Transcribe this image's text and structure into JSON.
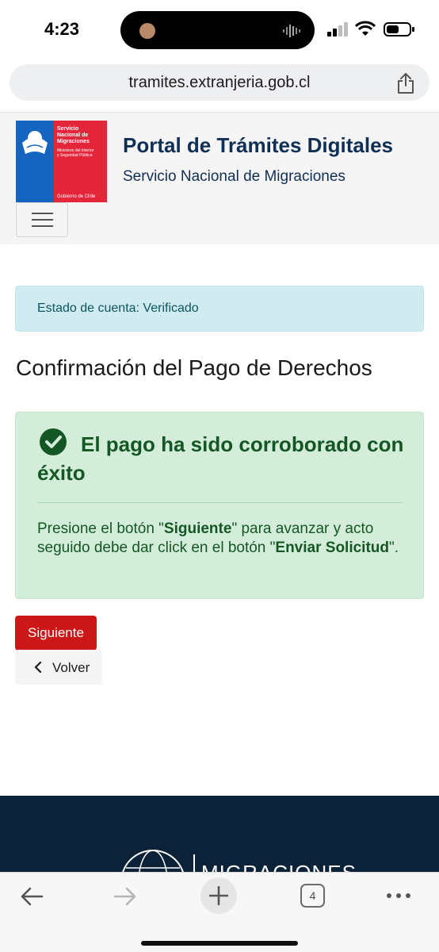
{
  "status_bar": {
    "time": "4:23"
  },
  "browser": {
    "url": "tramites.extranjeria.gob.cl",
    "tab_count": "4"
  },
  "header": {
    "logo": {
      "line1": "Servicio",
      "line2": "Nacional de",
      "line3": "Migraciones",
      "line4": "Ministerio del Interior",
      "line5": "y Seguridad Pública",
      "line6": "Gobierno de Chile"
    },
    "title": "Portal de Trámites Digitales",
    "subtitle": "Servicio Nacional de Migraciones"
  },
  "account_alert": {
    "text": "Estado de cuenta: Verificado"
  },
  "page_title": "Confirmación del Pago de Derechos",
  "success": {
    "heading": "El pago ha sido corroborado con éxito",
    "body_part1": "Presione el botón ",
    "body_quote1": "\"",
    "body_bold1": "Siguiente",
    "body_quote2": "\"",
    "body_part2": " para avanzar y acto seguido debe dar click en el botón ",
    "body_quote3": "\"",
    "body_bold2": "Enviar Solicitud",
    "body_quote4": "\"",
    "body_part3": "."
  },
  "actions": {
    "next_label": "Siguiente",
    "back_label": "Volver"
  },
  "footer": {
    "brand": "MIGRACIONES"
  },
  "colors": {
    "brand_blue": "#0f2f55",
    "brand_red": "#cc1719",
    "success_green": "#155724",
    "info_blue": "#0c5460",
    "footer_navy": "#0c2238"
  }
}
